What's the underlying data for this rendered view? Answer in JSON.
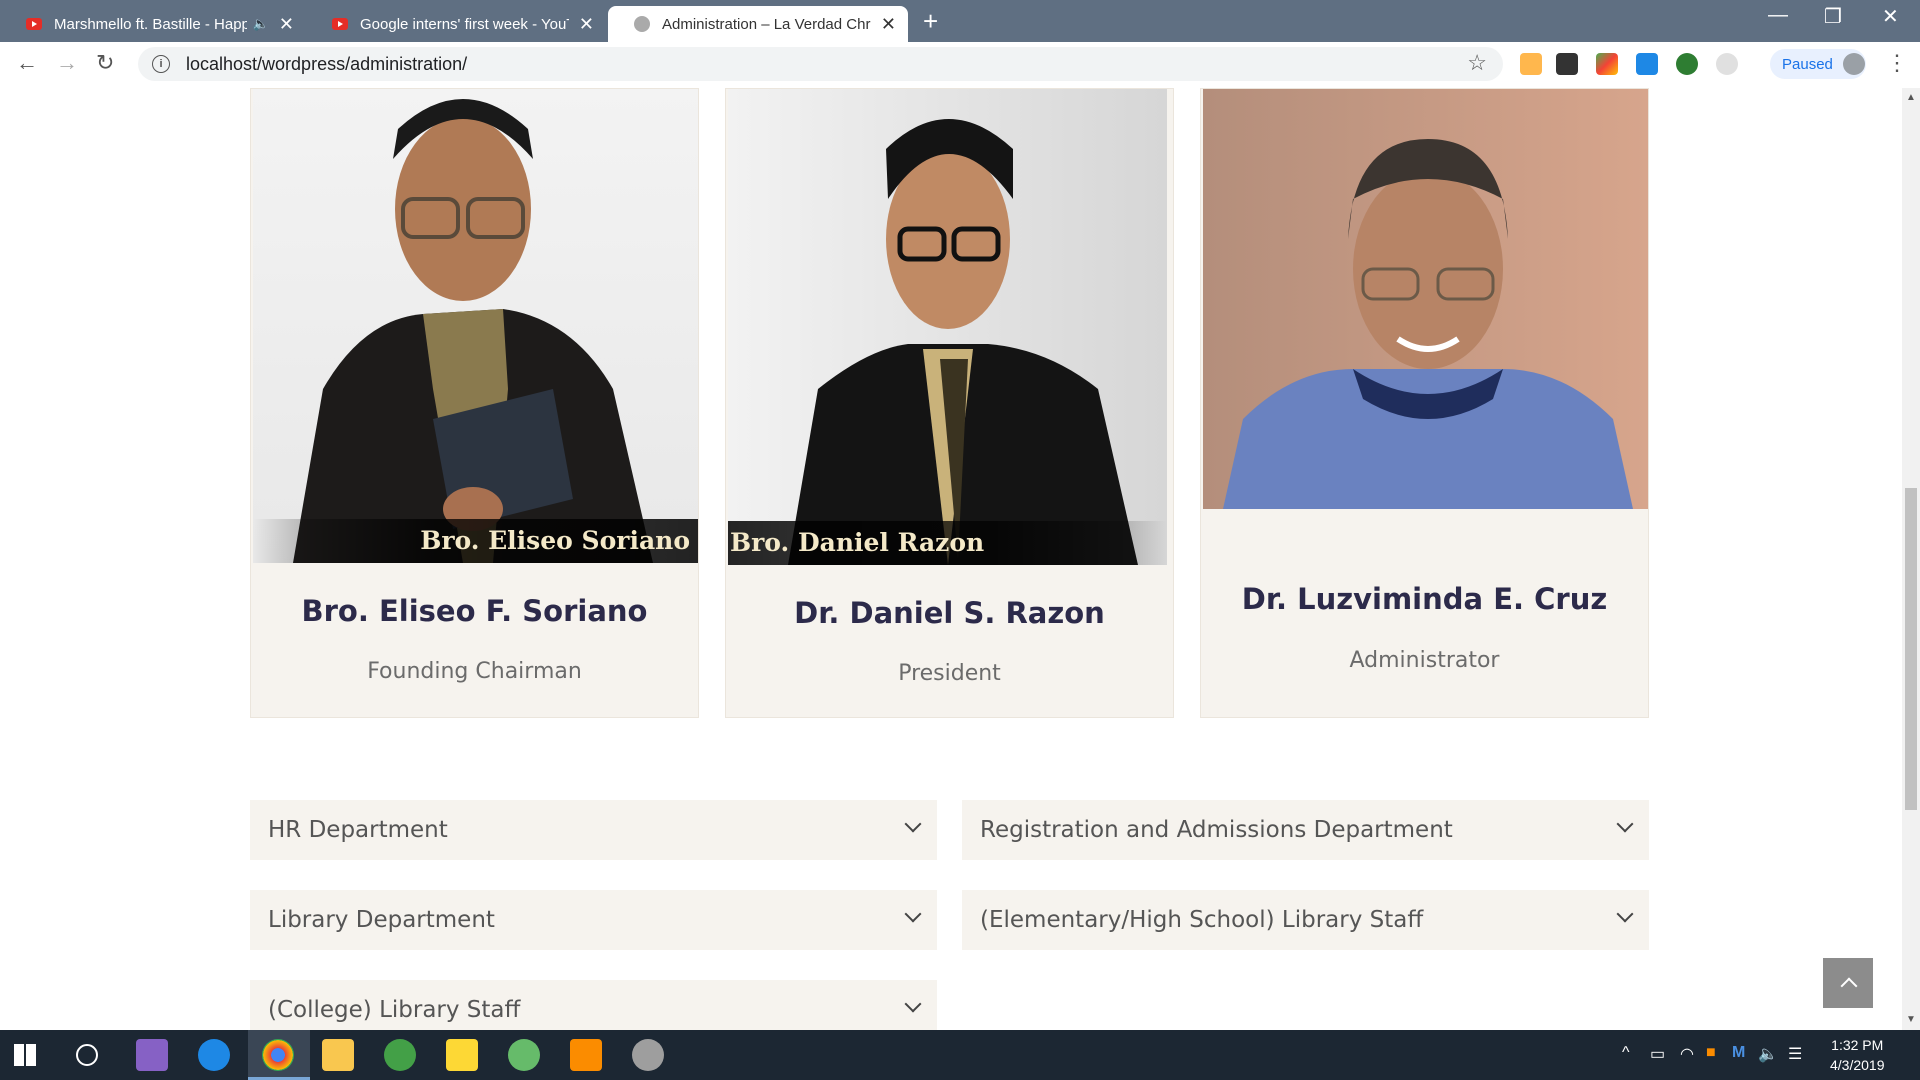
{
  "browser": {
    "tabs": [
      {
        "title": "Marshmello ft. Bastille - Happ",
        "audio": "🔈",
        "close": "✕"
      },
      {
        "title": "Google interns' first week - YouTu",
        "close": "✕"
      },
      {
        "title": "Administration – La Verdad Chris",
        "close": "✕"
      }
    ],
    "new_tab": "+",
    "window_controls": {
      "minimize": "—",
      "restore": "❐",
      "close": "✕"
    },
    "nav": {
      "back": "←",
      "forward": "→",
      "reload": "↻"
    },
    "url": "localhost/wordpress/administration/",
    "info_icon": "i",
    "star": "☆",
    "profile_status": "Paused",
    "menu": "⋮"
  },
  "people": [
    {
      "name": "Bro. Eliseo F. Soriano",
      "role": "Founding Chairman",
      "photo_caption": "Bro. Eliseo Soriano"
    },
    {
      "name": "Dr. Daniel S. Razon",
      "role": "President",
      "photo_caption": "Bro. Daniel Razon"
    },
    {
      "name": "Dr. Luzviminda E. Cruz",
      "role": "Administrator"
    }
  ],
  "departments": [
    "HR Department",
    "Registration and Admissions Department",
    "Library Department",
    "(Elementary/High School) Library Staff",
    "(College) Library Staff"
  ],
  "taskbar": {
    "time": "1:32 PM",
    "date": "4/3/2019"
  },
  "colors": {
    "card_bg": "#f6f3ee",
    "name_text": "#2c2a4a",
    "tab_bar": "#5f6f82",
    "taskbar": "#1c2733"
  }
}
